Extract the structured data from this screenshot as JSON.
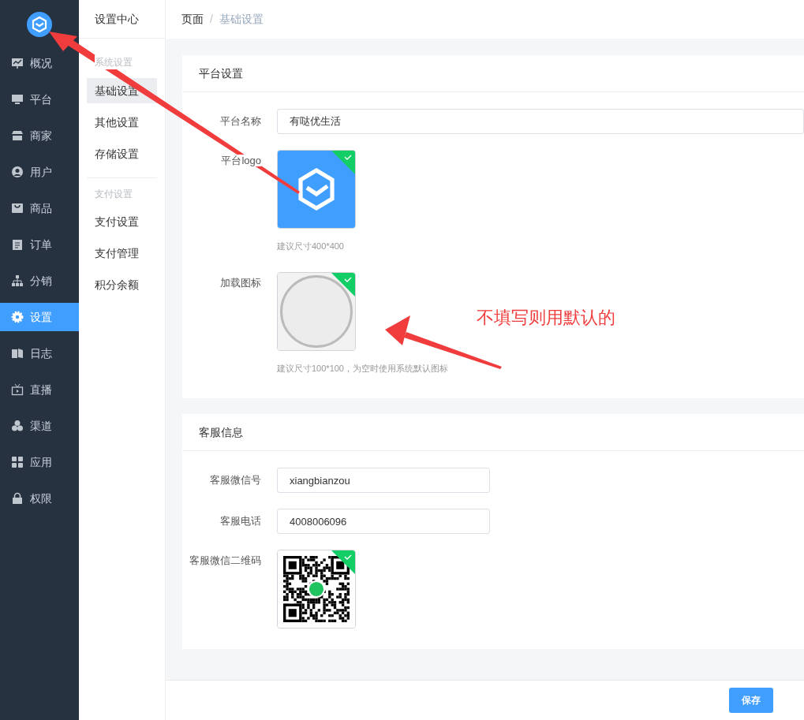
{
  "sidebar": {
    "items": [
      {
        "label": "概况",
        "selected": false
      },
      {
        "label": "平台",
        "selected": false
      },
      {
        "label": "商家",
        "selected": false
      },
      {
        "label": "用户",
        "selected": false
      },
      {
        "label": "商品",
        "selected": false
      },
      {
        "label": "订单",
        "selected": false
      },
      {
        "label": "分销",
        "selected": false
      },
      {
        "label": "设置",
        "selected": true
      },
      {
        "label": "日志",
        "selected": false
      },
      {
        "label": "直播",
        "selected": false
      },
      {
        "label": "渠道",
        "selected": false
      },
      {
        "label": "应用",
        "selected": false
      },
      {
        "label": "权限",
        "selected": false
      }
    ]
  },
  "submenu": {
    "title": "设置中心",
    "groups": [
      {
        "heading": "系统设置",
        "items": [
          {
            "label": "基础设置",
            "selected": true
          },
          {
            "label": "其他设置",
            "selected": false
          },
          {
            "label": "存储设置",
            "selected": false
          }
        ]
      },
      {
        "heading": "支付设置",
        "items": [
          {
            "label": "支付设置",
            "selected": false
          },
          {
            "label": "支付管理",
            "selected": false
          },
          {
            "label": "积分余额",
            "selected": false
          }
        ]
      }
    ]
  },
  "breadcrumb": {
    "items": [
      "页面",
      "基础设置"
    ],
    "separator": "/"
  },
  "cards": [
    {
      "title": "平台设置",
      "fields": [
        {
          "kind": "input",
          "label": "平台名称",
          "value": "有哒优生活"
        },
        {
          "kind": "logo",
          "label": "平台logo",
          "uploaded": true,
          "hint": "建议尺寸400*400"
        },
        {
          "kind": "emblem",
          "label": "加载图标",
          "uploaded": true,
          "hint": "建议尺寸100*100，为空时使用系统默认图标"
        }
      ]
    },
    {
      "title": "客服信息",
      "fields": [
        {
          "kind": "input",
          "label": "客服微信号",
          "value": "xiangbianzou"
        },
        {
          "kind": "input",
          "label": "客服电话",
          "value": "4008006096"
        },
        {
          "kind": "qrcode",
          "label": "客服微信二维码",
          "uploaded": true
        }
      ]
    }
  ],
  "save_button": "保存",
  "annotation": {
    "text": "不填写则用默认的"
  }
}
